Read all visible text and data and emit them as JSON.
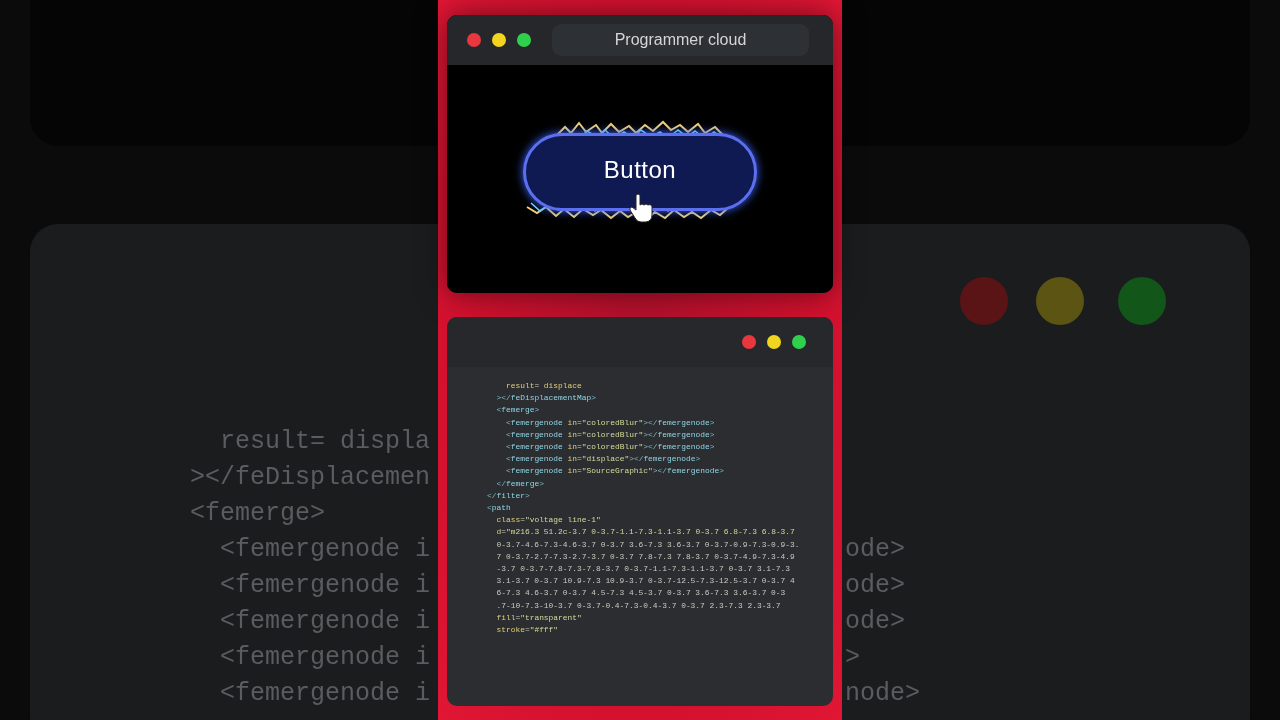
{
  "backdrop": {
    "code_lines": [
      "  result= displa",
      "></feDisplacemen",
      "<femerge>",
      "  <femergenode i",
      "  <femergenode i",
      "  <femergenode i",
      "  <femergenode i",
      "  <femergenode i"
    ],
    "right_fragments": [
      "ode>",
      "ode>",
      "ode>",
      ">",
      "node>"
    ]
  },
  "preview_window": {
    "title": "Programmer cloud",
    "button_label": "Button"
  },
  "editor_window": {
    "code_lines": [
      "    result= displace",
      "  ></feDisplacementMap>",
      "  <femerge>",
      "    <femergenode in=\"coloredBlur\"></femergenode>",
      "    <femergenode in=\"coloredBlur\"></femergenode>",
      "    <femergenode in=\"coloredBlur\"></femergenode>",
      "    <femergenode in=\"displace\"></femergenode>",
      "    <femergenode in=\"SourceGraphic\"></femergenode>",
      "  </femerge>",
      "</filter>",
      "<path",
      "  class=\"voltage line-1\"",
      "  d=\"m216.3 51.2c-3.7 0-3.7-1.1-7.3-1.1-3.7 0-3.7 6.8-7.3 6.8-3.7",
      "  0-3.7-4.6-7.3-4.6-3.7 0-3.7 3.6-7.3 3.6-3.7 0-3.7-0.9-7.3-0.9-3.",
      "  7 0-3.7-2.7-7.3-2.7-3.7 0-3.7 7.8-7.3 7.8-3.7 0-3.7-4.9-7.3-4.9",
      "  -3.7 0-3.7-7.8-7.3-7.8-3.7 0-3.7-1.1-7.3-1.1-3.7 0-3.7 3.1-7.3",
      "  3.1-3.7 0-3.7 10.9-7.3 10.9-3.7 0-3.7-12.5-7.3-12.5-3.7 0-3.7 4",
      "  6-7.3 4.6-3.7 0-3.7 4.5-7.3 4.5-3.7 0-3.7 3.6-7.3 3.6-3.7 0-3",
      "  .7-10-7.3-10-3.7 0-3.7-0.4-7.3-0.4-3.7 0-3.7 2.3-7.3 2.3-3.7",
      "  fill=\"transparent\"",
      "  stroke=\"#fff\""
    ]
  }
}
